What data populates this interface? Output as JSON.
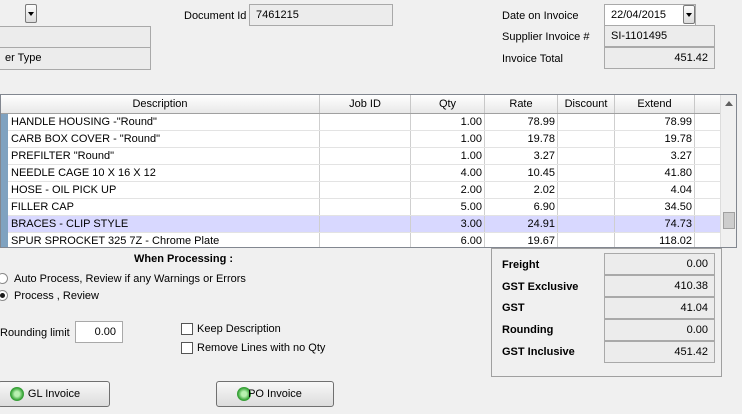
{
  "header": {
    "document_id_label": "Document Id",
    "document_id_value": "7461215",
    "supplier_type_label": "er Type",
    "date_label": "Date on Invoice",
    "date_value": "22/04/2015",
    "supplier_invoice_label": "Supplier Invoice #",
    "supplier_invoice_value": "SI-1101495",
    "invoice_total_label": "Invoice Total",
    "invoice_total_value": "451.42"
  },
  "grid": {
    "columns": [
      "Description",
      "Job ID",
      "Qty",
      "Rate",
      "Discount",
      "Extend"
    ],
    "rows": [
      {
        "description": "HANDLE HOUSING -\"Round\"",
        "job_id": "",
        "qty": "1.00",
        "rate": "78.99",
        "discount": "",
        "extend": "78.99"
      },
      {
        "description": "CARB BOX COVER - \"Round\"",
        "job_id": "",
        "qty": "1.00",
        "rate": "19.78",
        "discount": "",
        "extend": "19.78"
      },
      {
        "description": "PREFILTER \"Round\"",
        "job_id": "",
        "qty": "1.00",
        "rate": "3.27",
        "discount": "",
        "extend": "3.27"
      },
      {
        "description": "NEEDLE CAGE 10 X 16 X 12",
        "job_id": "",
        "qty": "4.00",
        "rate": "10.45",
        "discount": "",
        "extend": "41.80"
      },
      {
        "description": "HOSE - OIL PICK UP",
        "job_id": "",
        "qty": "2.00",
        "rate": "2.02",
        "discount": "",
        "extend": "4.04"
      },
      {
        "description": "FILLER CAP",
        "job_id": "",
        "qty": "5.00",
        "rate": "6.90",
        "discount": "",
        "extend": "34.50"
      },
      {
        "description": "BRACES - CLIP STYLE",
        "job_id": "",
        "qty": "3.00",
        "rate": "24.91",
        "discount": "",
        "extend": "74.73"
      },
      {
        "description": "SPUR SPROCKET 325 7Z - Chrome Plate",
        "job_id": "",
        "qty": "6.00",
        "rate": "19.67",
        "discount": "",
        "extend": "118.02"
      }
    ]
  },
  "processing": {
    "title": "When Processing :",
    "option_auto": "Auto Process,  Review if any Warnings or Errors",
    "option_review": "Process , Review",
    "rounding_label": "Rounding limit",
    "rounding_value": "0.00",
    "keep_description_label": "Keep Description",
    "remove_lines_label": "Remove Lines with no Qty"
  },
  "totals": {
    "freight_label": "Freight",
    "freight_value": "0.00",
    "gst_exclusive_label": "GST Exclusive",
    "gst_exclusive_value": "410.38",
    "gst_label": "GST",
    "gst_value": "41.04",
    "rounding_label": "Rounding",
    "rounding_value": "0.00",
    "gst_inclusive_label": "GST Inclusive",
    "gst_inclusive_value": "451.42"
  },
  "buttons": {
    "gl_invoice": "GL Invoice",
    "po_invoice": "PO Invoice"
  }
}
